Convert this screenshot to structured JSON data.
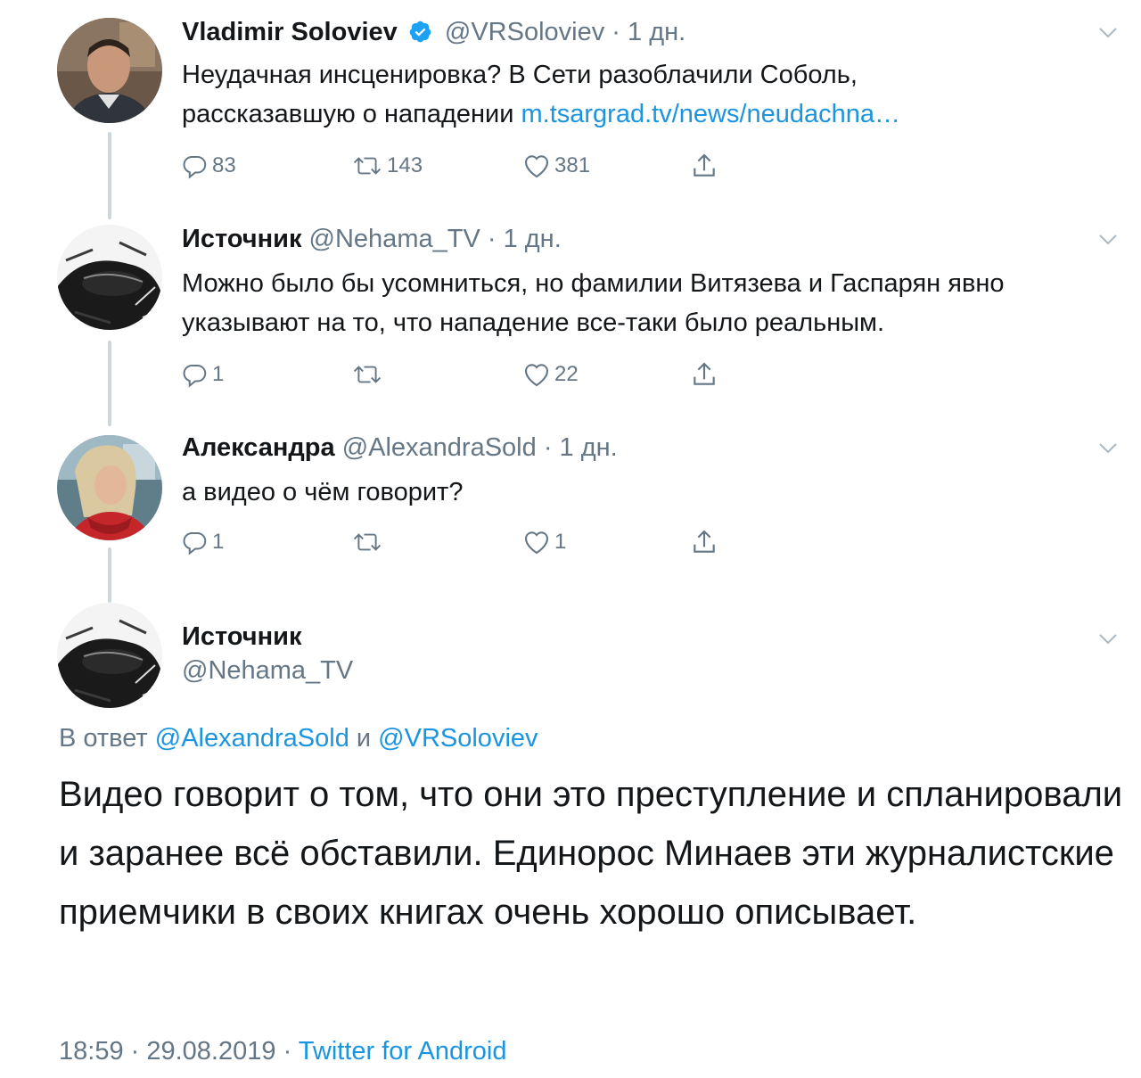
{
  "tweets": [
    {
      "name": "Vladimir Soloviev",
      "verified": true,
      "handle": "@VRSoloviev",
      "time": "· 1 дн.",
      "text": "Неудачная инсценировка? В Сети разоблачили Соболь, рассказавшую о нападении ",
      "link": "m.tsargrad.tv/news/neudachna…",
      "replies": "83",
      "retweets": "143",
      "likes": "381"
    },
    {
      "name": "Источник",
      "handle": "@Nehama_TV",
      "time": "· 1 дн.",
      "text": "Можно было бы усомниться, но фамилии Витязева и Гаспарян явно указывают на то, что нападение все-таки было реальным.",
      "replies": "1",
      "retweets": "",
      "likes": "22"
    },
    {
      "name": "Александра",
      "handle": "@AlexandraSold",
      "time": "· 1 дн.",
      "text": "а видео о чём говорит?",
      "replies": "1",
      "retweets": "",
      "likes": "1"
    }
  ],
  "main_tweet": {
    "name": "Источник",
    "handle": "@Nehama_TV",
    "reply_prefix": "В ответ ",
    "reply_user1": "@AlexandraSold",
    "reply_and": " и ",
    "reply_user2": "@VRSoloviev",
    "text": "Видео говорит о том, что они это преступление и спланировали и заранее всё обставили. Единорос Минаев эти журналистские  приемчики в своих книгах очень хорошо описывает.",
    "time": "18:59",
    "sep1": " · ",
    "date": "29.08.2019",
    "sep2": " · ",
    "client": "Twitter for Android"
  },
  "colors": {
    "accent": "#1b95e0",
    "secondary_text": "#657786",
    "thread_line": "#ccd6dd"
  },
  "icons": [
    "verified-badge-icon",
    "chevron-down-icon",
    "reply-icon",
    "retweet-icon",
    "like-icon",
    "share-icon"
  ]
}
